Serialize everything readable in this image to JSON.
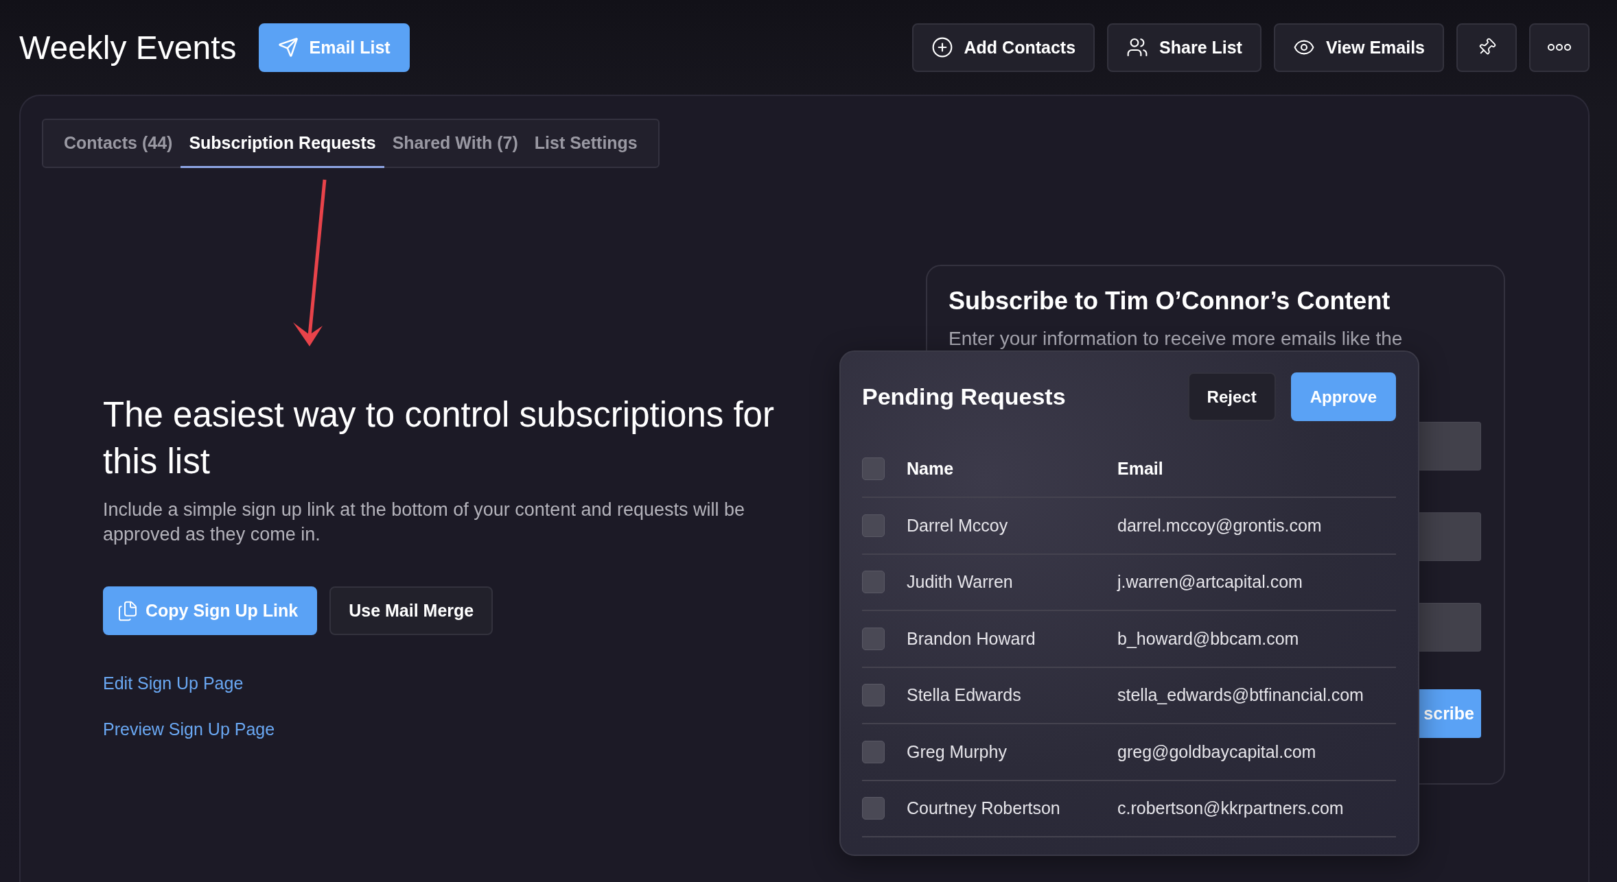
{
  "header": {
    "title": "Weekly Events",
    "primary_button": "Email List",
    "actions": [
      {
        "label": "Add Contacts"
      },
      {
        "label": "Share List"
      },
      {
        "label": "View Emails"
      }
    ]
  },
  "tabs": [
    {
      "label": "Contacts (44)",
      "selected": false
    },
    {
      "label": "Subscription Requests",
      "selected": true
    },
    {
      "label": "Shared With (7)",
      "selected": false
    },
    {
      "label": "List Settings",
      "selected": false
    }
  ],
  "intro": {
    "heading": "The easiest way to control subscriptions for this list",
    "description": "Include a simple sign up link at the bottom of your content and requests will be approved as they come in.",
    "buttons": [
      {
        "label": "Copy Sign Up Link",
        "primary": true
      },
      {
        "label": "Use Mail Merge",
        "primary": false
      }
    ],
    "links": [
      "Edit Sign Up Page",
      "Preview Sign Up Page"
    ]
  },
  "subscribe_card": {
    "title": "Subscribe to Tim O’Connor’s Content",
    "subtitle": "Enter your information to receive more emails like the",
    "button": "scribe"
  },
  "pending": {
    "title": "Pending Requests",
    "reject": "Reject",
    "approve": "Approve",
    "columns": [
      "Name",
      "Email"
    ],
    "select_all": false,
    "rows": [
      {
        "name": "Darrel Mccoy",
        "email": "darrel.mccoy@grontis.com",
        "checked": false
      },
      {
        "name": "Judith Warren",
        "email": "j.warren@artcapital.com",
        "checked": false
      },
      {
        "name": "Brandon Howard",
        "email": "b_howard@bbcam.com",
        "checked": false
      },
      {
        "name": "Stella Edwards",
        "email": "stella_edwards@btfinancial.com",
        "checked": false
      },
      {
        "name": "Greg Murphy",
        "email": "greg@goldbaycapital.com",
        "checked": false
      },
      {
        "name": "Courtney Robertson",
        "email": "c.robertson@kkrpartners.com",
        "checked": false
      }
    ]
  }
}
